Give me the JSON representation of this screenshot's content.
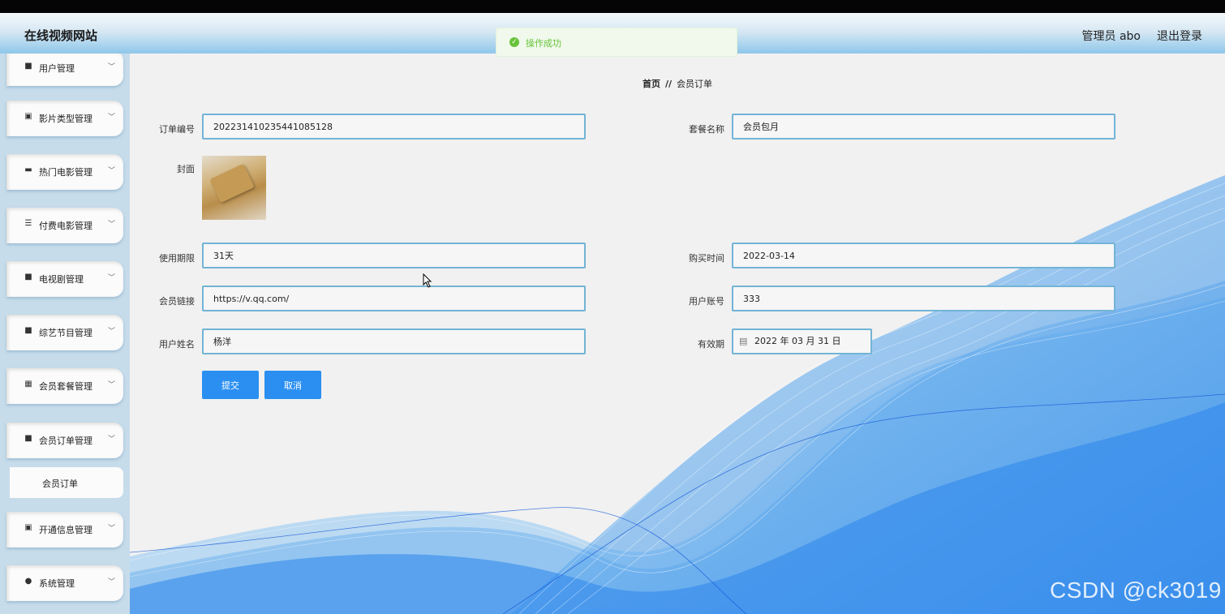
{
  "header": {
    "site_title": "在线视频网站",
    "user_info": "管理员 abo",
    "logout": "退出登录"
  },
  "toast": {
    "message": "操作成功",
    "icon": "check-circle-icon",
    "color": "#67c23a"
  },
  "sidebar": {
    "items": [
      {
        "label": "用户管理",
        "icon": "grid-icon",
        "glyph": "■"
      },
      {
        "label": "影片类型管理",
        "icon": "clipboard-icon",
        "glyph": "▣"
      },
      {
        "label": "热门电影管理",
        "icon": "briefcase-icon",
        "glyph": "▬"
      },
      {
        "label": "付费电影管理",
        "icon": "sliders-icon",
        "glyph": "☰"
      },
      {
        "label": "电视剧管理",
        "icon": "grid-icon",
        "glyph": "■"
      },
      {
        "label": "综艺节目管理",
        "icon": "grid-icon",
        "glyph": "■"
      },
      {
        "label": "会员套餐管理",
        "icon": "apps-icon",
        "glyph": "▦"
      },
      {
        "label": "会员订单管理",
        "icon": "grid-icon",
        "glyph": "■"
      },
      {
        "label": "开通信息管理",
        "icon": "clipboard-icon",
        "glyph": "▣"
      },
      {
        "label": "系统管理",
        "icon": "user-icon",
        "glyph": "●"
      }
    ],
    "submenu_label": "会员订单"
  },
  "breadcrumb": {
    "home": "首页",
    "separator": "//",
    "current": "会员订单"
  },
  "form": {
    "order_no": {
      "label": "订单编号",
      "value": "202231410235441085128"
    },
    "package_name": {
      "label": "套餐名称",
      "value": "会员包月"
    },
    "cover": {
      "label": "封面"
    },
    "duration": {
      "label": "使用期限",
      "value": "31天"
    },
    "purchase_time": {
      "label": "购买时间",
      "value": "2022-03-14"
    },
    "member_link": {
      "label": "会员链接",
      "value": "https://v.qq.com/"
    },
    "user_account": {
      "label": "用户账号",
      "value": "333"
    },
    "user_name": {
      "label": "用户姓名",
      "value": "杨洋"
    },
    "expiry": {
      "label": "有效期",
      "value": "2022 年 03 月 31 日",
      "icon": "calendar-icon"
    }
  },
  "buttons": {
    "submit": "提交",
    "cancel": "取消"
  },
  "watermark": "CSDN @ck3019",
  "colors": {
    "accent": "#2a8ff0",
    "input_border": "#72b4d6",
    "header_border": "#6fb8e6"
  }
}
